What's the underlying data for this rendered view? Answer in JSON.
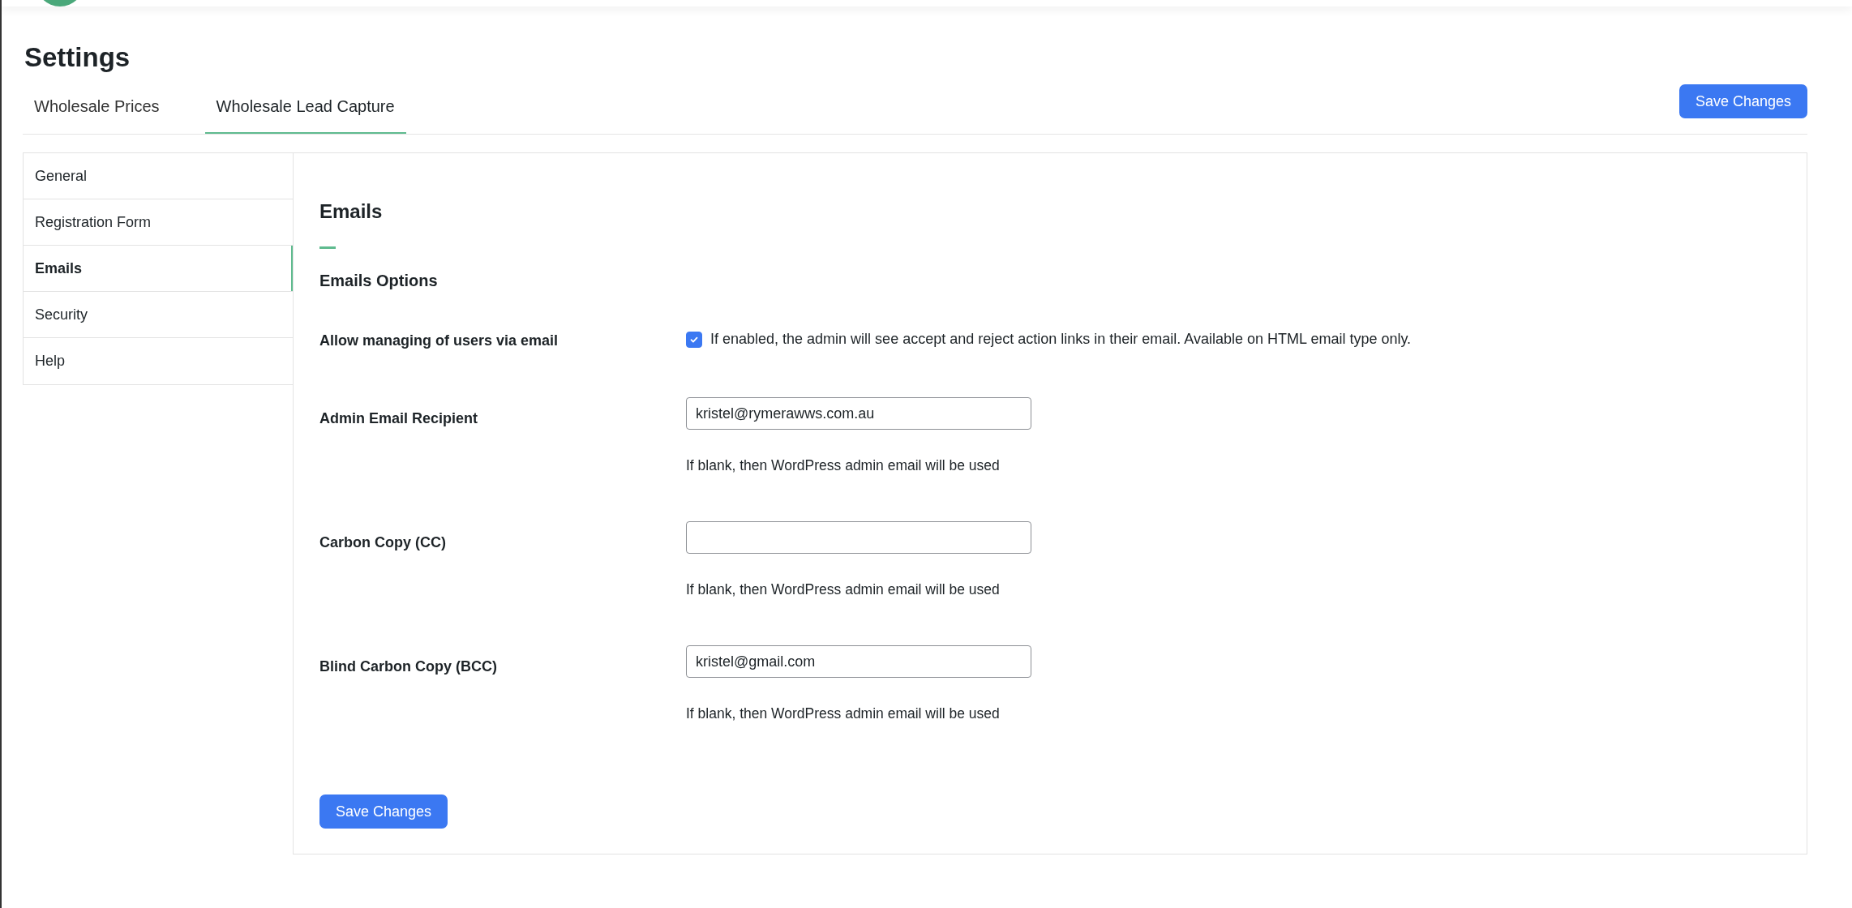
{
  "title": "Settings",
  "tabs": [
    {
      "label": "Wholesale Prices",
      "selected": false
    },
    {
      "label": "Wholesale Lead Capture",
      "selected": true
    }
  ],
  "top_save_button": "Save Changes",
  "sidebar": {
    "items": [
      {
        "label": "General",
        "selected": false
      },
      {
        "label": "Registration Form",
        "selected": false
      },
      {
        "label": "Emails",
        "selected": true
      },
      {
        "label": "Security",
        "selected": false
      },
      {
        "label": "Help",
        "selected": false
      }
    ]
  },
  "section_title": "Emails",
  "subsection_title": "Emails Options",
  "fields": [
    {
      "kind": "checkbox",
      "label": "Allow managing of users via email",
      "checked": true,
      "description": "If enabled, the admin will see accept and reject action links in their email. Available on HTML email type only."
    },
    {
      "kind": "text",
      "label": "Admin Email Recipient",
      "value": "kristel@rymerawws.com.au",
      "hint": "If blank, then WordPress admin email will be used"
    },
    {
      "kind": "text",
      "label": "Carbon Copy (CC)",
      "hint": "If blank, then WordPress admin email will be used"
    },
    {
      "kind": "text",
      "label": "Blind Carbon Copy (BCC)",
      "value": "kristel@gmail.com",
      "hint": "If blank, then WordPress admin email will be used"
    }
  ],
  "bottom_save_button": "Save Changes"
}
